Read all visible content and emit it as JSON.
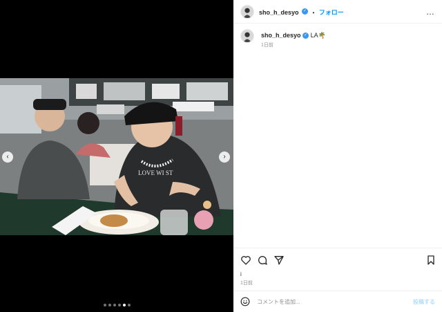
{
  "post": {
    "username": "sho_h_desyo",
    "verified_mark": "✓",
    "separator": "•",
    "follow_label": "フォロー",
    "more_label": "…",
    "caption_username": "sho_h_desyo",
    "caption_text": "LA🌴",
    "caption_time": "1日前",
    "likes_text": "i",
    "post_time": "1日前"
  },
  "media": {
    "prev_label": "‹",
    "next_label": "›",
    "slide_count": 6,
    "active_slide_index": 4,
    "photo_shirt_text": "LOVE WI        ST"
  },
  "comment": {
    "placeholder": "コメントを追加...",
    "post_label": "投稿する"
  },
  "icons": {
    "like": "heart-icon",
    "comment": "comment-bubble-icon",
    "share": "paper-plane-icon",
    "save": "bookmark-icon",
    "emoji": "smiley-icon"
  },
  "colors": {
    "accent": "#0095f6",
    "verified": "#3897f0",
    "post_disabled": "#b2dffc",
    "muted": "#8e8e8e"
  }
}
